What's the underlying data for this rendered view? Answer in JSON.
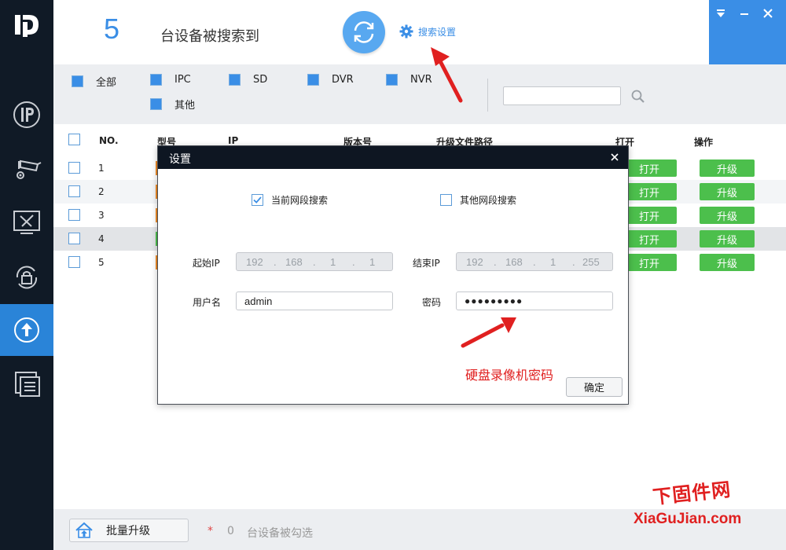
{
  "header": {
    "found_count": "5",
    "found_text": "台设备被搜索到",
    "search_settings_label": "搜索设置"
  },
  "filter": {
    "options": [
      "全部",
      "IPC",
      "SD",
      "DVR",
      "NVR",
      "其他"
    ]
  },
  "table": {
    "headers": [
      "NO.",
      "型号",
      "IP",
      "版本号",
      "升级文件路径",
      "打开",
      "操作"
    ],
    "rows": [
      {
        "no": "1",
        "open": "打开",
        "action": "升级"
      },
      {
        "no": "2",
        "open": "打开",
        "action": "升级"
      },
      {
        "no": "3",
        "open": "打开",
        "action": "升级"
      },
      {
        "no": "4",
        "open": "打开",
        "action": "升级"
      },
      {
        "no": "5",
        "open": "打开",
        "action": "升级"
      }
    ]
  },
  "footer": {
    "batch_label": "批量升级",
    "star": "*",
    "selected_count": "0",
    "selected_text": "台设备被勾选"
  },
  "dialog": {
    "title": "设置",
    "current_segment": "当前网段搜索",
    "other_segment": "其他网段搜索",
    "start_ip_label": "起始IP",
    "start_ip": [
      "192",
      "168",
      "1",
      "1"
    ],
    "end_ip_label": "结束IP",
    "end_ip": [
      "192",
      "168",
      "1",
      "255"
    ],
    "ip_dot": ".",
    "username_label": "用户名",
    "username": "admin",
    "password_label": "密码",
    "password_masked": "●●●●●●●●●",
    "ok_label": "确定",
    "annotation": "硬盘录像机密码"
  },
  "watermark": {
    "cn": "下固件网",
    "en": "XiaGuJian.com"
  },
  "colors": {
    "sidebar_bg": "#101a26",
    "accent": "#3a8ee6",
    "green_button": "#4cbf4c",
    "annotation_red": "#e02020"
  }
}
